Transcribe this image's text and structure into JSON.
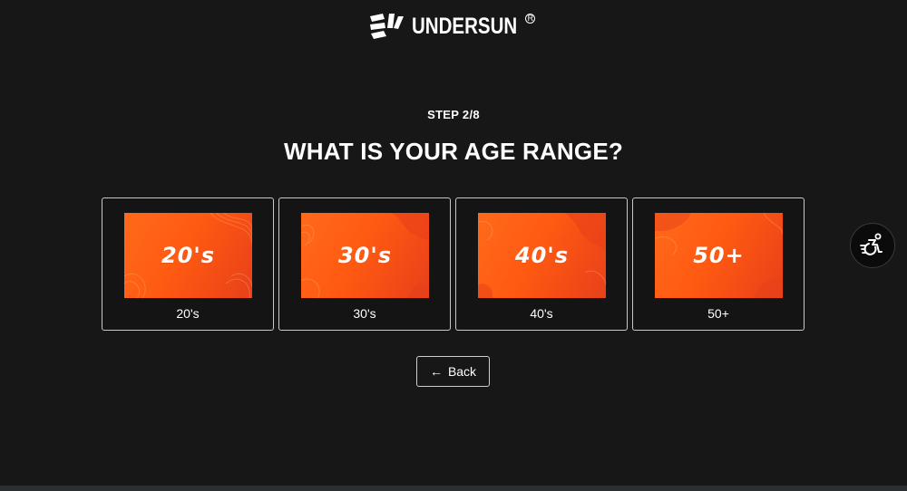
{
  "brand": {
    "logo_text": "UNDERSUN",
    "registered_mark": "R"
  },
  "quiz": {
    "step_label": "STEP 2/8",
    "question": "WHAT IS YOUR AGE RANGE?",
    "options": [
      {
        "image_text": "20's",
        "label": "20's"
      },
      {
        "image_text": "30's",
        "label": "30's"
      },
      {
        "image_text": "40's",
        "label": "40's"
      },
      {
        "image_text": "50+",
        "label": "50+"
      }
    ],
    "back_label": "Back",
    "back_icon": "arrow-left-icon"
  },
  "accessibility": {
    "icon": "accessibility-wheelchair-icon"
  },
  "colors": {
    "background": "#171717",
    "accent_orange": "#ff5a12",
    "border": "#c9c9c9",
    "text": "#ffffff"
  }
}
